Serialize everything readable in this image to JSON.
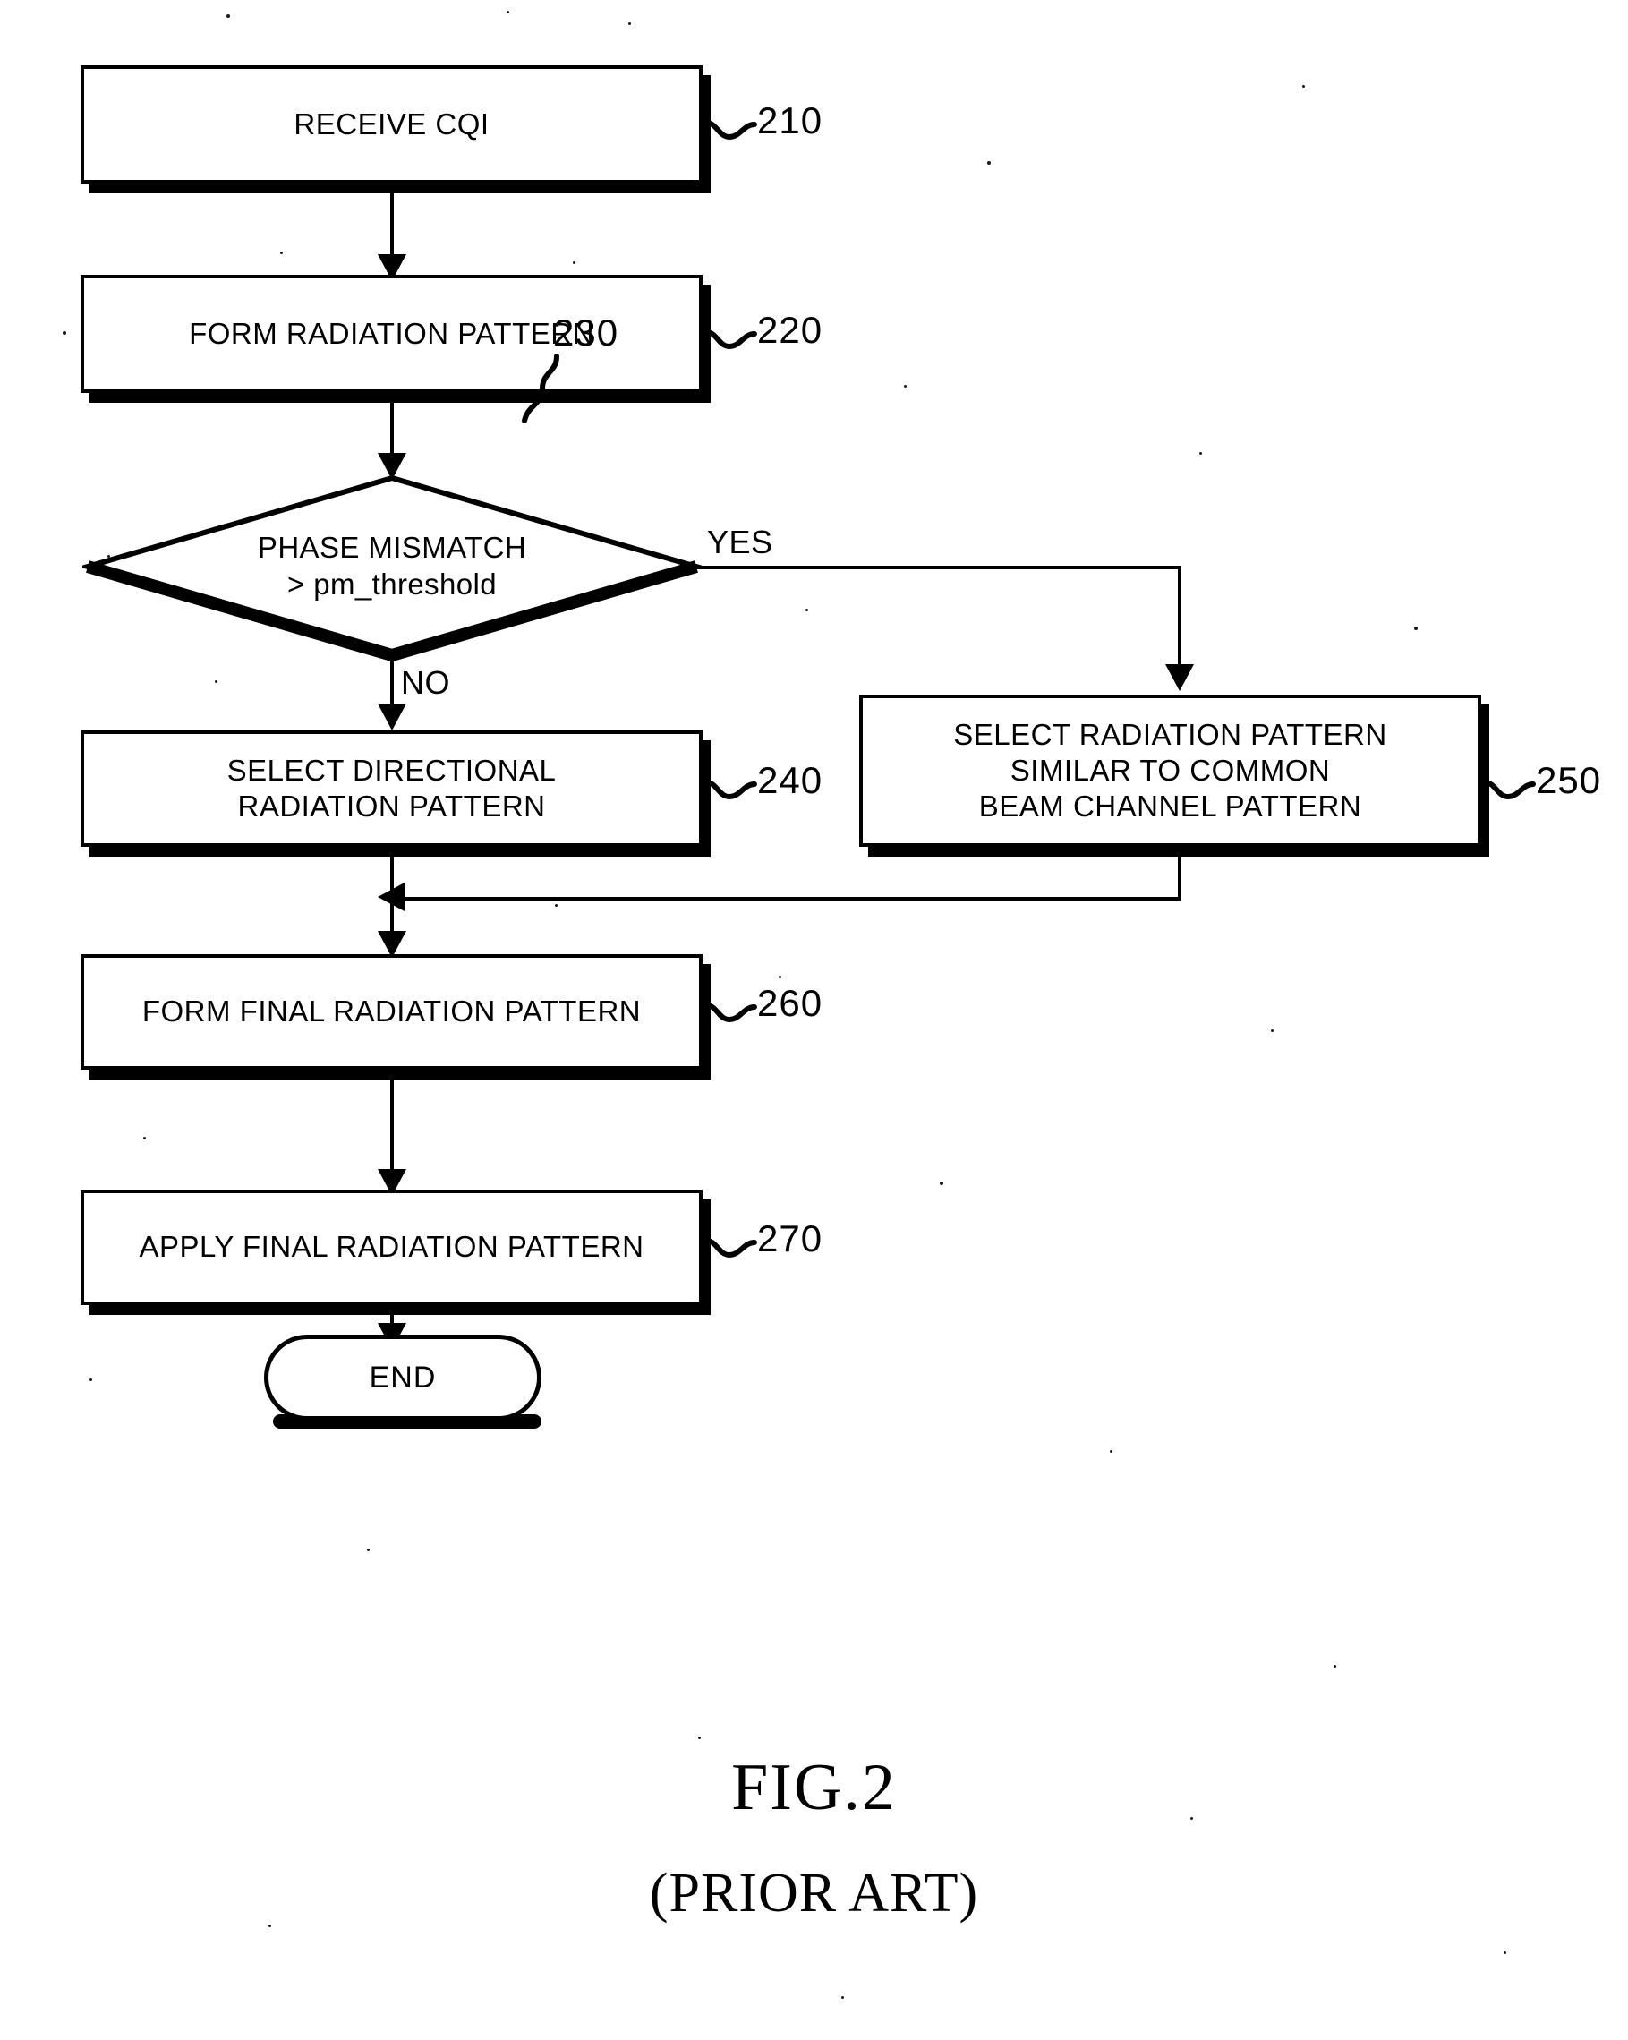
{
  "figure": {
    "caption_main": "FIG.2",
    "caption_sub": "(PRIOR ART)"
  },
  "flowchart": {
    "nodes": [
      {
        "id": "n210",
        "type": "process",
        "label": "RECEIVE CQI",
        "ref": "210"
      },
      {
        "id": "n220",
        "type": "process",
        "label": "FORM RADIATION PATTERN",
        "ref": "220"
      },
      {
        "id": "n230",
        "type": "decision",
        "label_line1": "PHASE MISMATCH",
        "label_line2": "> pm_threshold",
        "ref": "230"
      },
      {
        "id": "n240",
        "type": "process",
        "label_line1": "SELECT DIRECTIONAL",
        "label_line2": "RADIATION PATTERN",
        "ref": "240"
      },
      {
        "id": "n250",
        "type": "process",
        "label_line1": "SELECT RADIATION PATTERN",
        "label_line2": "SIMILAR TO COMMON",
        "label_line3": "BEAM CHANNEL PATTERN",
        "ref": "250"
      },
      {
        "id": "n260",
        "type": "process",
        "label": "FORM FINAL RADIATION PATTERN",
        "ref": "260"
      },
      {
        "id": "n270",
        "type": "process",
        "label": "APPLY FINAL RADIATION PATTERN",
        "ref": "270"
      },
      {
        "id": "nend",
        "type": "terminator",
        "label": "END"
      }
    ],
    "branch_labels": {
      "yes": "YES",
      "no": "NO"
    }
  },
  "colors": {
    "ink": "#000000",
    "paper": "#ffffff"
  }
}
